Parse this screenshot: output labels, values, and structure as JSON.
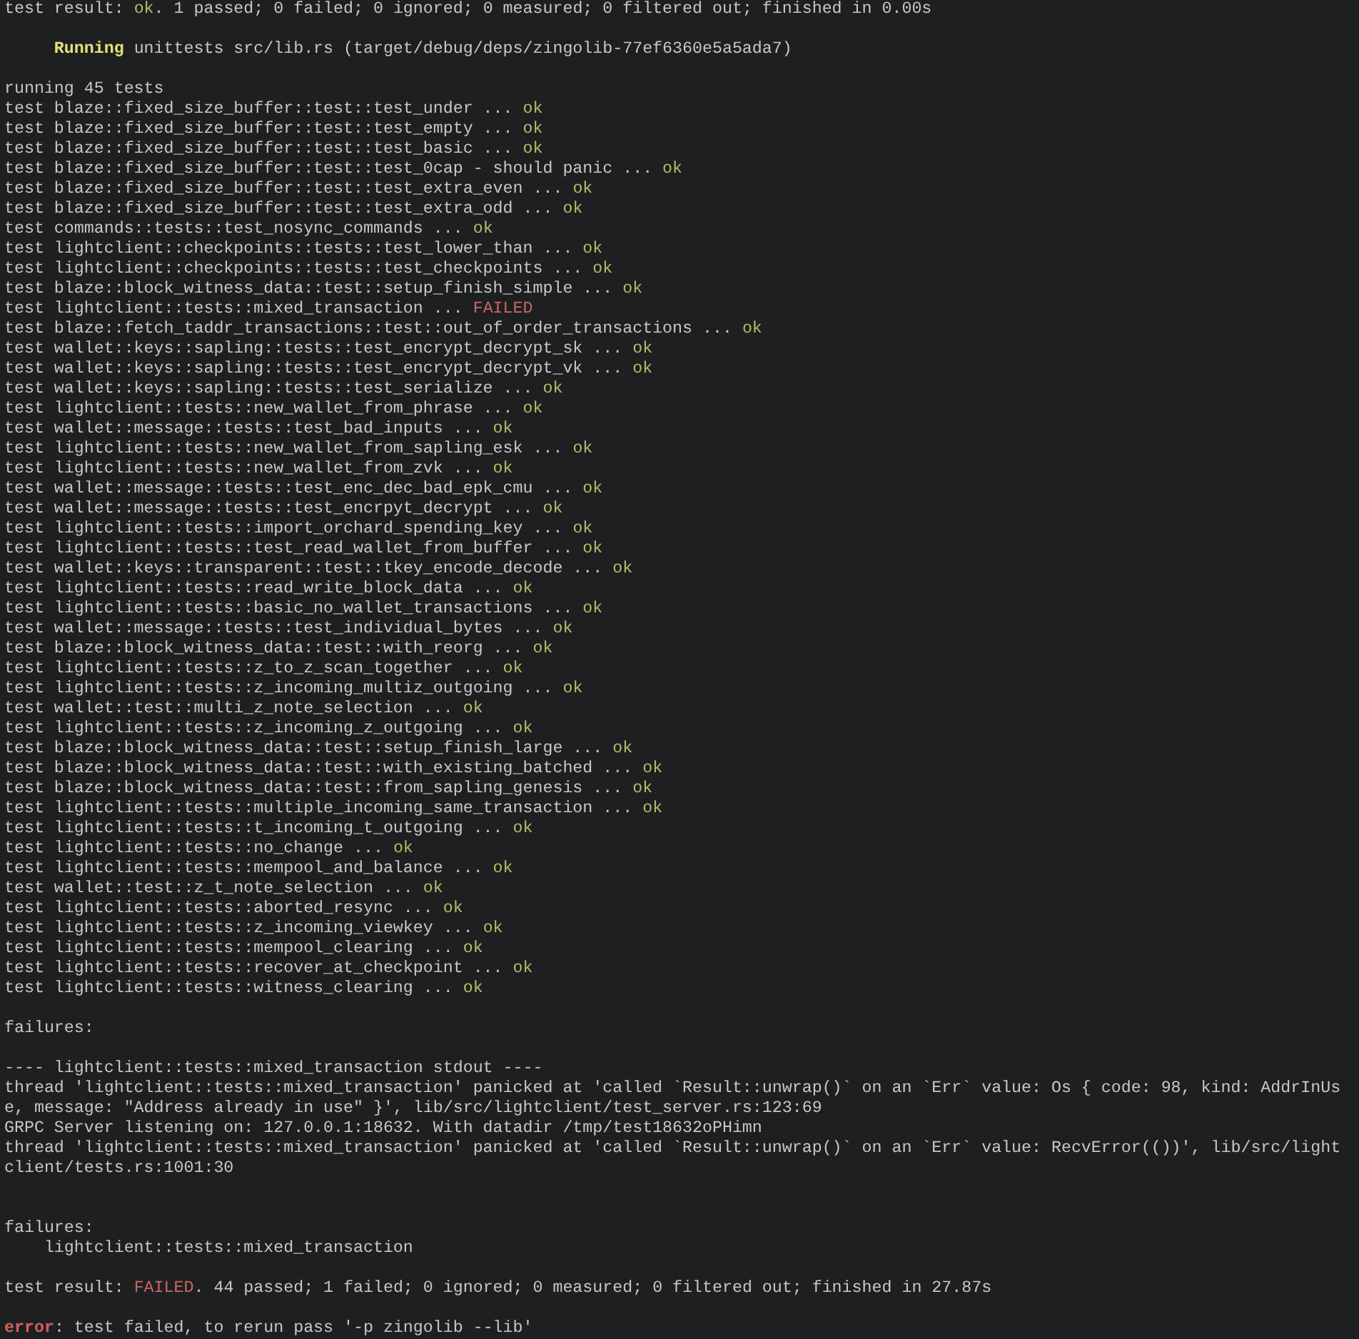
{
  "terminal": {
    "lines": [
      {
        "kind": "text",
        "segments": [
          {
            "text": "test result: "
          },
          {
            "text": "ok",
            "kind": "ok"
          },
          {
            "text": ". 1 passed; 0 failed; 0 ignored; 0 measured; 0 filtered out; finished in 0.00s"
          }
        ]
      },
      {
        "kind": "blank"
      },
      {
        "kind": "header",
        "segments": [
          {
            "text": "Running",
            "kind": "running"
          },
          {
            "text": " unittests src/lib.rs (target/debug/deps/zingolib-77ef6360e5a5ada7)"
          }
        ]
      },
      {
        "kind": "blank"
      },
      {
        "kind": "text",
        "segments": [
          {
            "text": "running 45 tests"
          }
        ]
      },
      {
        "kind": "text",
        "segments": [
          {
            "text": "test blaze::fixed_size_buffer::test::test_under ... "
          },
          {
            "text": "ok",
            "kind": "ok"
          }
        ]
      },
      {
        "kind": "text",
        "segments": [
          {
            "text": "test blaze::fixed_size_buffer::test::test_empty ... "
          },
          {
            "text": "ok",
            "kind": "ok"
          }
        ]
      },
      {
        "kind": "text",
        "segments": [
          {
            "text": "test blaze::fixed_size_buffer::test::test_basic ... "
          },
          {
            "text": "ok",
            "kind": "ok"
          }
        ]
      },
      {
        "kind": "text",
        "segments": [
          {
            "text": "test blaze::fixed_size_buffer::test::test_0cap - should panic ... "
          },
          {
            "text": "ok",
            "kind": "ok"
          }
        ]
      },
      {
        "kind": "text",
        "segments": [
          {
            "text": "test blaze::fixed_size_buffer::test::test_extra_even ... "
          },
          {
            "text": "ok",
            "kind": "ok"
          }
        ]
      },
      {
        "kind": "text",
        "segments": [
          {
            "text": "test blaze::fixed_size_buffer::test::test_extra_odd ... "
          },
          {
            "text": "ok",
            "kind": "ok"
          }
        ]
      },
      {
        "kind": "text",
        "segments": [
          {
            "text": "test commands::tests::test_nosync_commands ... "
          },
          {
            "text": "ok",
            "kind": "ok"
          }
        ]
      },
      {
        "kind": "text",
        "segments": [
          {
            "text": "test lightclient::checkpoints::tests::test_lower_than ... "
          },
          {
            "text": "ok",
            "kind": "ok"
          }
        ]
      },
      {
        "kind": "text",
        "segments": [
          {
            "text": "test lightclient::checkpoints::tests::test_checkpoints ... "
          },
          {
            "text": "ok",
            "kind": "ok"
          }
        ]
      },
      {
        "kind": "text",
        "segments": [
          {
            "text": "test blaze::block_witness_data::test::setup_finish_simple ... "
          },
          {
            "text": "ok",
            "kind": "ok"
          }
        ]
      },
      {
        "kind": "text",
        "segments": [
          {
            "text": "test lightclient::tests::mixed_transaction ... "
          },
          {
            "text": "FAILED",
            "kind": "failed"
          }
        ]
      },
      {
        "kind": "text",
        "segments": [
          {
            "text": "test blaze::fetch_taddr_transactions::test::out_of_order_transactions ... "
          },
          {
            "text": "ok",
            "kind": "ok"
          }
        ]
      },
      {
        "kind": "text",
        "segments": [
          {
            "text": "test wallet::keys::sapling::tests::test_encrypt_decrypt_sk ... "
          },
          {
            "text": "ok",
            "kind": "ok"
          }
        ]
      },
      {
        "kind": "text",
        "segments": [
          {
            "text": "test wallet::keys::sapling::tests::test_encrypt_decrypt_vk ... "
          },
          {
            "text": "ok",
            "kind": "ok"
          }
        ]
      },
      {
        "kind": "text",
        "segments": [
          {
            "text": "test wallet::keys::sapling::tests::test_serialize ... "
          },
          {
            "text": "ok",
            "kind": "ok"
          }
        ]
      },
      {
        "kind": "text",
        "segments": [
          {
            "text": "test lightclient::tests::new_wallet_from_phrase ... "
          },
          {
            "text": "ok",
            "kind": "ok"
          }
        ]
      },
      {
        "kind": "text",
        "segments": [
          {
            "text": "test wallet::message::tests::test_bad_inputs ... "
          },
          {
            "text": "ok",
            "kind": "ok"
          }
        ]
      },
      {
        "kind": "text",
        "segments": [
          {
            "text": "test lightclient::tests::new_wallet_from_sapling_esk ... "
          },
          {
            "text": "ok",
            "kind": "ok"
          }
        ]
      },
      {
        "kind": "text",
        "segments": [
          {
            "text": "test lightclient::tests::new_wallet_from_zvk ... "
          },
          {
            "text": "ok",
            "kind": "ok"
          }
        ]
      },
      {
        "kind": "text",
        "segments": [
          {
            "text": "test wallet::message::tests::test_enc_dec_bad_epk_cmu ... "
          },
          {
            "text": "ok",
            "kind": "ok"
          }
        ]
      },
      {
        "kind": "text",
        "segments": [
          {
            "text": "test wallet::message::tests::test_encrpyt_decrypt ... "
          },
          {
            "text": "ok",
            "kind": "ok"
          }
        ]
      },
      {
        "kind": "text",
        "segments": [
          {
            "text": "test lightclient::tests::import_orchard_spending_key ... "
          },
          {
            "text": "ok",
            "kind": "ok"
          }
        ]
      },
      {
        "kind": "text",
        "segments": [
          {
            "text": "test lightclient::tests::test_read_wallet_from_buffer ... "
          },
          {
            "text": "ok",
            "kind": "ok"
          }
        ]
      },
      {
        "kind": "text",
        "segments": [
          {
            "text": "test wallet::keys::transparent::test::tkey_encode_decode ... "
          },
          {
            "text": "ok",
            "kind": "ok"
          }
        ]
      },
      {
        "kind": "text",
        "segments": [
          {
            "text": "test lightclient::tests::read_write_block_data ... "
          },
          {
            "text": "ok",
            "kind": "ok"
          }
        ]
      },
      {
        "kind": "text",
        "segments": [
          {
            "text": "test lightclient::tests::basic_no_wallet_transactions ... "
          },
          {
            "text": "ok",
            "kind": "ok"
          }
        ]
      },
      {
        "kind": "text",
        "segments": [
          {
            "text": "test wallet::message::tests::test_individual_bytes ... "
          },
          {
            "text": "ok",
            "kind": "ok"
          }
        ]
      },
      {
        "kind": "text",
        "segments": [
          {
            "text": "test blaze::block_witness_data::test::with_reorg ... "
          },
          {
            "text": "ok",
            "kind": "ok"
          }
        ]
      },
      {
        "kind": "text",
        "segments": [
          {
            "text": "test lightclient::tests::z_to_z_scan_together ... "
          },
          {
            "text": "ok",
            "kind": "ok"
          }
        ]
      },
      {
        "kind": "text",
        "segments": [
          {
            "text": "test lightclient::tests::z_incoming_multiz_outgoing ... "
          },
          {
            "text": "ok",
            "kind": "ok"
          }
        ]
      },
      {
        "kind": "text",
        "segments": [
          {
            "text": "test wallet::test::multi_z_note_selection ... "
          },
          {
            "text": "ok",
            "kind": "ok"
          }
        ]
      },
      {
        "kind": "text",
        "segments": [
          {
            "text": "test lightclient::tests::z_incoming_z_outgoing ... "
          },
          {
            "text": "ok",
            "kind": "ok"
          }
        ]
      },
      {
        "kind": "text",
        "segments": [
          {
            "text": "test blaze::block_witness_data::test::setup_finish_large ... "
          },
          {
            "text": "ok",
            "kind": "ok"
          }
        ]
      },
      {
        "kind": "text",
        "segments": [
          {
            "text": "test blaze::block_witness_data::test::with_existing_batched ... "
          },
          {
            "text": "ok",
            "kind": "ok"
          }
        ]
      },
      {
        "kind": "text",
        "segments": [
          {
            "text": "test blaze::block_witness_data::test::from_sapling_genesis ... "
          },
          {
            "text": "ok",
            "kind": "ok"
          }
        ]
      },
      {
        "kind": "text",
        "segments": [
          {
            "text": "test lightclient::tests::multiple_incoming_same_transaction ... "
          },
          {
            "text": "ok",
            "kind": "ok"
          }
        ]
      },
      {
        "kind": "text",
        "segments": [
          {
            "text": "test lightclient::tests::t_incoming_t_outgoing ... "
          },
          {
            "text": "ok",
            "kind": "ok"
          }
        ]
      },
      {
        "kind": "text",
        "segments": [
          {
            "text": "test lightclient::tests::no_change ... "
          },
          {
            "text": "ok",
            "kind": "ok"
          }
        ]
      },
      {
        "kind": "text",
        "segments": [
          {
            "text": "test lightclient::tests::mempool_and_balance ... "
          },
          {
            "text": "ok",
            "kind": "ok"
          }
        ]
      },
      {
        "kind": "text",
        "segments": [
          {
            "text": "test wallet::test::z_t_note_selection ... "
          },
          {
            "text": "ok",
            "kind": "ok"
          }
        ]
      },
      {
        "kind": "text",
        "segments": [
          {
            "text": "test lightclient::tests::aborted_resync ... "
          },
          {
            "text": "ok",
            "kind": "ok"
          }
        ]
      },
      {
        "kind": "text",
        "segments": [
          {
            "text": "test lightclient::tests::z_incoming_viewkey ... "
          },
          {
            "text": "ok",
            "kind": "ok"
          }
        ]
      },
      {
        "kind": "text",
        "segments": [
          {
            "text": "test lightclient::tests::mempool_clearing ... "
          },
          {
            "text": "ok",
            "kind": "ok"
          }
        ]
      },
      {
        "kind": "text",
        "segments": [
          {
            "text": "test lightclient::tests::recover_at_checkpoint ... "
          },
          {
            "text": "ok",
            "kind": "ok"
          }
        ]
      },
      {
        "kind": "text",
        "segments": [
          {
            "text": "test lightclient::tests::witness_clearing ... "
          },
          {
            "text": "ok",
            "kind": "ok"
          }
        ]
      },
      {
        "kind": "blank"
      },
      {
        "kind": "text",
        "segments": [
          {
            "text": "failures:"
          }
        ]
      },
      {
        "kind": "blank"
      },
      {
        "kind": "text",
        "segments": [
          {
            "text": "---- lightclient::tests::mixed_transaction stdout ----"
          }
        ]
      },
      {
        "kind": "text",
        "segments": [
          {
            "text": "thread 'lightclient::tests::mixed_transaction' panicked at 'called `Result::unwrap()` on an `Err` value: Os { code: 98, kind: AddrInUs"
          }
        ]
      },
      {
        "kind": "text",
        "segments": [
          {
            "text": "e, message: \"Address already in use\" }', lib/src/lightclient/test_server.rs:123:69"
          }
        ]
      },
      {
        "kind": "text",
        "segments": [
          {
            "text": "GRPC Server listening on: 127.0.0.1:18632. With datadir /tmp/test18632oPHimn"
          }
        ]
      },
      {
        "kind": "text",
        "segments": [
          {
            "text": "thread 'lightclient::tests::mixed_transaction' panicked at 'called `Result::unwrap()` on an `Err` value: RecvError(())', lib/src/light"
          }
        ]
      },
      {
        "kind": "text",
        "segments": [
          {
            "text": "client/tests.rs:1001:30"
          }
        ]
      },
      {
        "kind": "blank"
      },
      {
        "kind": "blank"
      },
      {
        "kind": "text",
        "segments": [
          {
            "text": "failures:"
          }
        ]
      },
      {
        "kind": "indented",
        "segments": [
          {
            "text": "lightclient::tests::mixed_transaction"
          }
        ]
      },
      {
        "kind": "blank"
      },
      {
        "kind": "text",
        "segments": [
          {
            "text": "test result: "
          },
          {
            "text": "FAILED",
            "kind": "failed"
          },
          {
            "text": ". 44 passed; 1 failed; 0 ignored; 0 measured; 0 filtered out; finished in 27.87s"
          }
        ]
      },
      {
        "kind": "blank"
      },
      {
        "kind": "text",
        "segments": [
          {
            "text": "error",
            "kind": "error"
          },
          {
            "text": ": test failed, to rerun pass '-p zingolib --lib'"
          }
        ]
      }
    ]
  }
}
